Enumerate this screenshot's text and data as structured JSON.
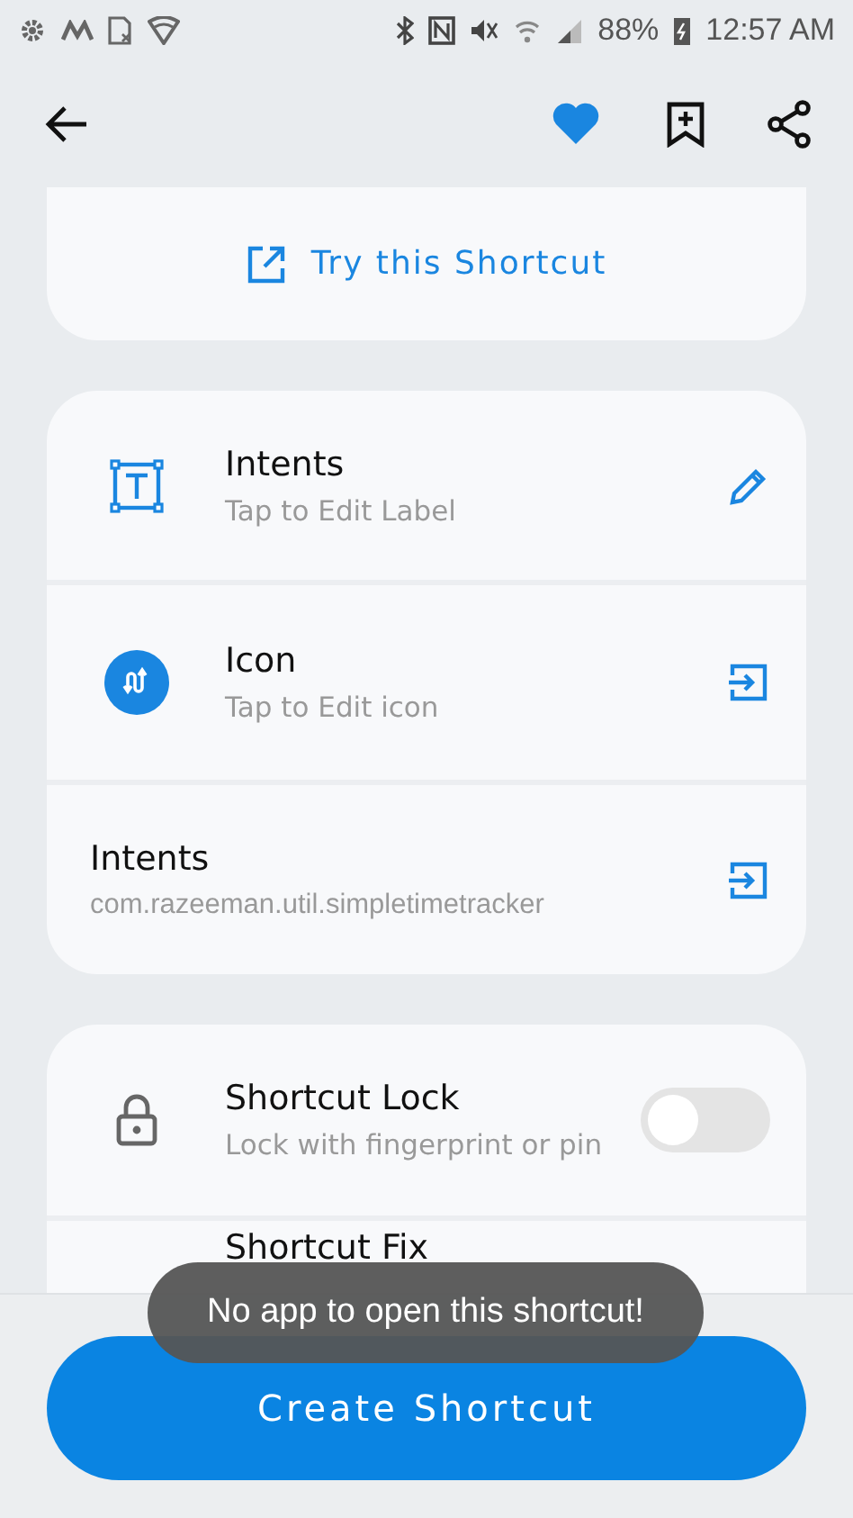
{
  "status_bar": {
    "battery": "88%",
    "time": "12:57 AM"
  },
  "app_bar": {
    "favorite": true
  },
  "try_card": {
    "label": "Try this Shortcut"
  },
  "details_card": {
    "rows": [
      {
        "kind": "label",
        "title": "Intents",
        "subtitle": "Tap to Edit Label",
        "editable": true
      },
      {
        "kind": "icon",
        "title": "Icon",
        "subtitle": "Tap to Edit icon",
        "editable": false
      },
      {
        "kind": "plain",
        "title": "Intents",
        "subtitle": "com.razeeman.util.simpletimetracker",
        "editable": false
      }
    ]
  },
  "options_card": {
    "rows": [
      {
        "kind": "lock",
        "title": "Shortcut Lock",
        "subtitle": "Lock with fingerprint or pin",
        "on": false
      },
      {
        "kind": "fix",
        "title": "Shortcut Fix"
      }
    ]
  },
  "toast": {
    "message": "No app to open this shortcut!"
  },
  "create_button": {
    "label": "Create Shortcut"
  }
}
